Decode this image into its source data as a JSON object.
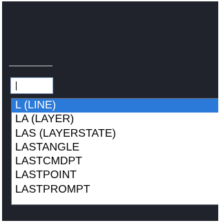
{
  "command_input": {
    "value": ""
  },
  "autocomplete": {
    "selected_index": 0,
    "items": [
      {
        "label": "L (LINE)"
      },
      {
        "label": "LA (LAYER)"
      },
      {
        "label": "LAS (LAYERSTATE)"
      },
      {
        "label": "LASTANGLE"
      },
      {
        "label": "LASTCMDPT"
      },
      {
        "label": "LASTPOINT"
      },
      {
        "label": "LASTPROMPT"
      }
    ]
  },
  "colors": {
    "canvas_background": "#20232b",
    "selection_highlight": "#2b79d8",
    "list_background": "#ffffff"
  }
}
